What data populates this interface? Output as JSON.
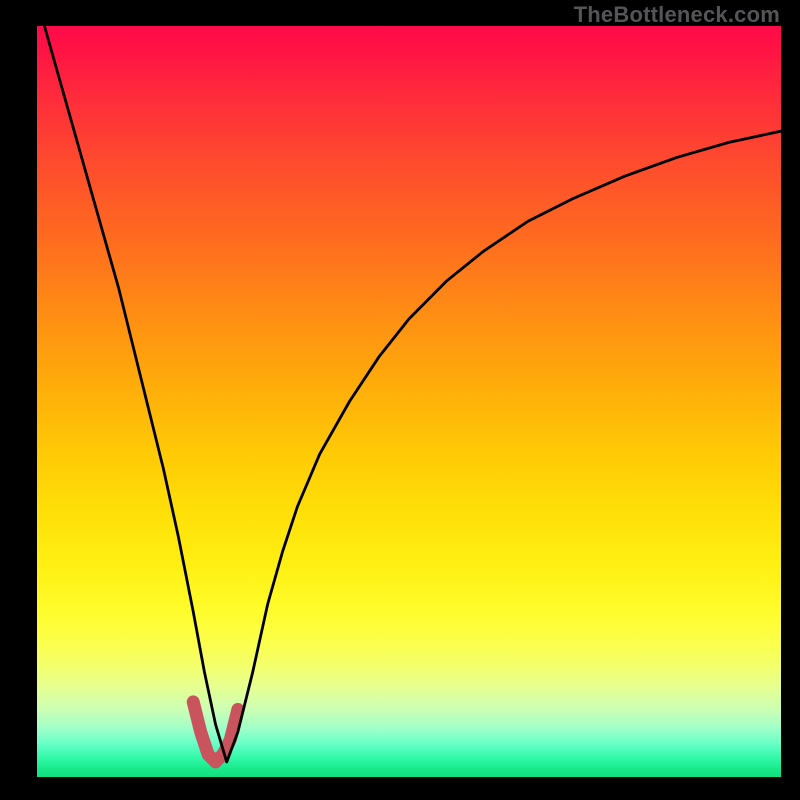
{
  "watermark": "TheBottleneck.com",
  "chart_data": {
    "type": "line",
    "title": "",
    "xlabel": "",
    "ylabel": "",
    "xlim": [
      0,
      100
    ],
    "ylim": [
      0,
      100
    ],
    "series": [
      {
        "name": "bottleneck-curve",
        "x": [
          1,
          3,
          5,
          7,
          9,
          11,
          13,
          15,
          17,
          19,
          21,
          22.5,
          24,
          25.5,
          27,
          29,
          31,
          33,
          35,
          38,
          42,
          46,
          50,
          55,
          60,
          66,
          72,
          79,
          86,
          93,
          100
        ],
        "values": [
          100,
          93,
          86,
          79,
          72,
          65,
          57,
          49,
          41,
          32,
          22,
          14,
          7,
          2,
          6,
          14,
          23,
          30,
          36,
          43,
          50,
          56,
          61,
          66,
          70,
          74,
          77,
          80,
          82.5,
          84.5,
          86
        ]
      },
      {
        "name": "highlight-segment",
        "x": [
          21,
          22,
          23,
          24,
          25,
          26,
          27
        ],
        "values": [
          10,
          6,
          3,
          2,
          3,
          5,
          9
        ]
      }
    ],
    "annotations": []
  }
}
